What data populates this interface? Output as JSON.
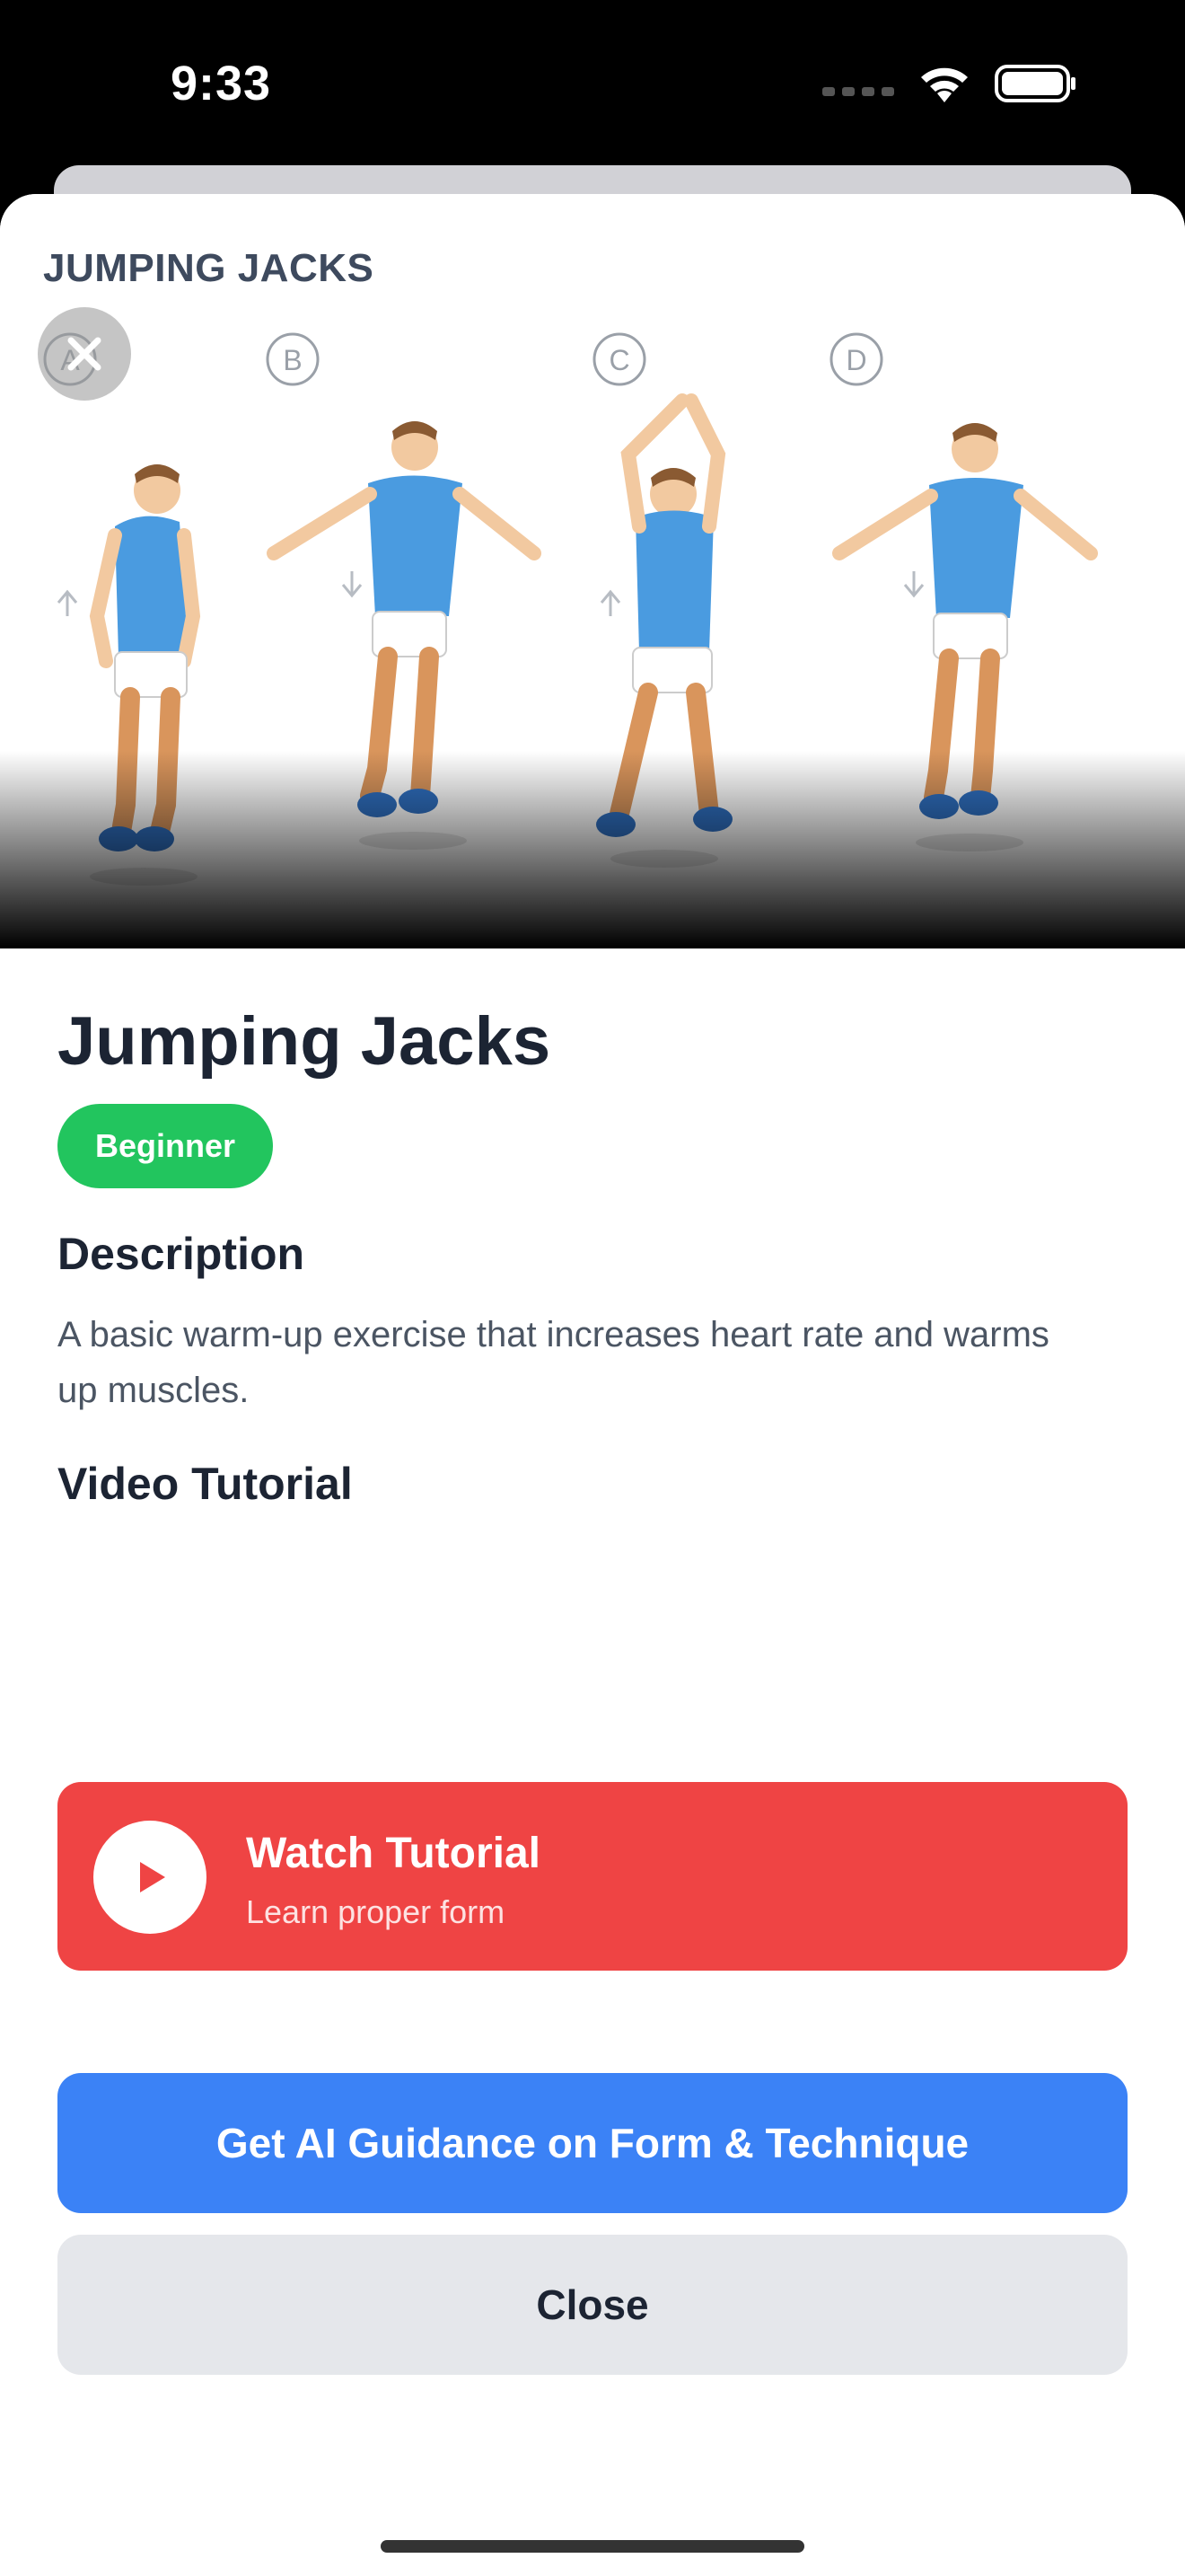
{
  "status_bar": {
    "time": "9:33"
  },
  "hero": {
    "image_title": "JUMPING JACKS",
    "step_labels": [
      "A",
      "B",
      "C",
      "D"
    ]
  },
  "exercise": {
    "name": "Jumping Jacks",
    "difficulty": "Beginner",
    "description_heading": "Description",
    "description": "A basic warm-up exercise that increases heart rate and warms up muscles.",
    "video_heading": "Video Tutorial"
  },
  "video_card": {
    "title": "Watch Tutorial",
    "subtitle": "Learn proper form"
  },
  "actions": {
    "ai_guidance_label": "Get AI Guidance on Form & Technique",
    "close_label": "Close"
  },
  "colors": {
    "badge": "#22c55e",
    "video_card": "#ef4444",
    "primary_button": "#3b82f6",
    "secondary_button": "#e5e7eb",
    "shirt": "#4a9be0"
  },
  "icons": {
    "close": "close-icon",
    "play": "play-icon",
    "wifi": "wifi-icon",
    "battery": "battery-icon"
  }
}
